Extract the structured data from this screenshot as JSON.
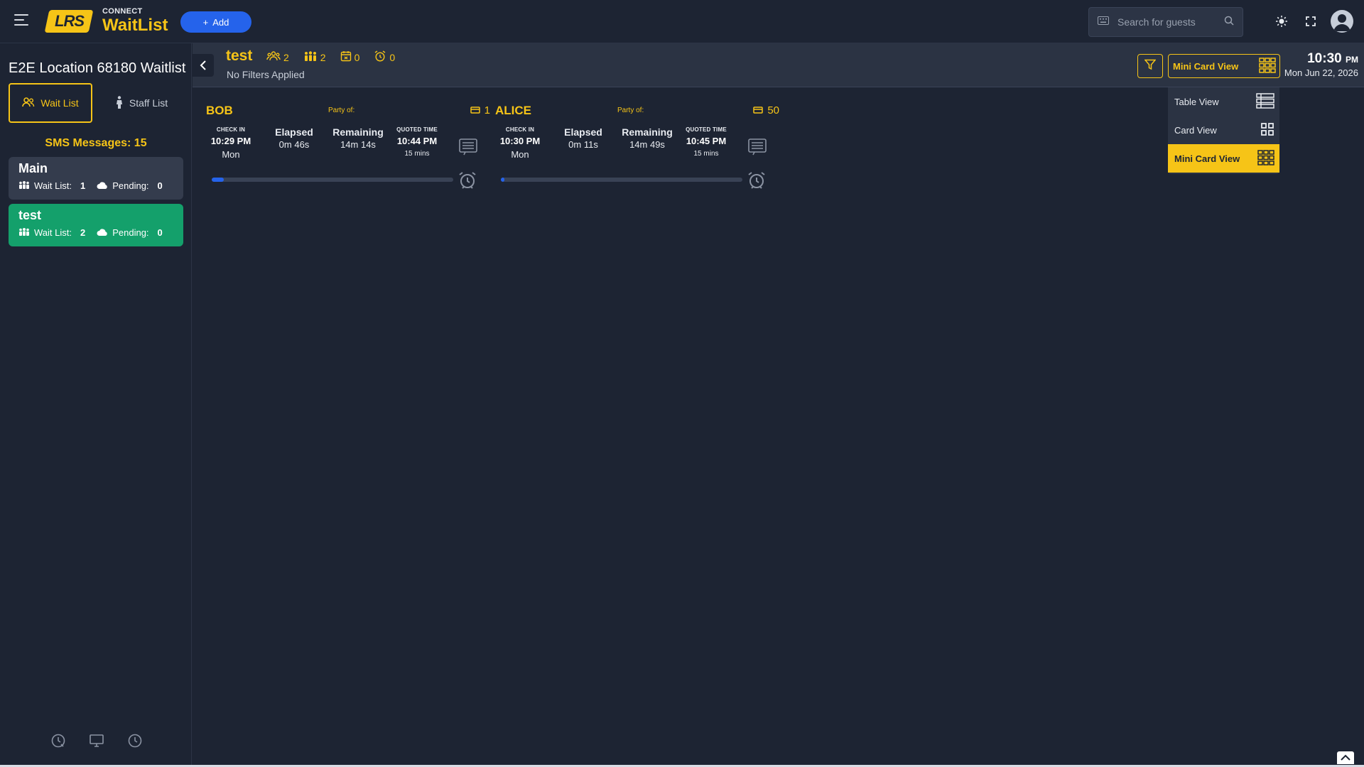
{
  "app": {
    "logo_text": "LRS",
    "product_small": "CONNECT",
    "product_big": "WaitList",
    "add_label": "Add"
  },
  "search": {
    "placeholder": "Search for guests"
  },
  "sidebar": {
    "location_title": "E2E Location 68180 Waitlist",
    "tabs": [
      {
        "label": "Wait List",
        "active": true
      },
      {
        "label": "Staff List",
        "active": false
      }
    ],
    "sms_label": "SMS Messages: 15",
    "lists": [
      {
        "name": "Main",
        "waitlist_label": "Wait List:",
        "waitlist_count": "1",
        "pending_label": "Pending:",
        "pending_count": "0"
      },
      {
        "name": "test",
        "waitlist_label": "Wait List:",
        "waitlist_count": "2",
        "pending_label": "Pending:",
        "pending_count": "0"
      }
    ]
  },
  "subheader": {
    "list_name": "test",
    "stats": {
      "parties": "2",
      "guests": "2",
      "reservations": "0",
      "alarms": "0"
    },
    "filters_text": "No Filters Applied",
    "view_selected": "Mini Card View",
    "time": "10:30",
    "ampm": "PM",
    "date": "Mon Jun 22, 2026"
  },
  "view_menu": [
    {
      "label": "Table View",
      "icon": "table-view-icon"
    },
    {
      "label": "Card View",
      "icon": "card-view-icon"
    },
    {
      "label": "Mini Card View",
      "icon": "mini-card-view-icon",
      "selected": true
    }
  ],
  "guests": [
    {
      "name": "BOB",
      "party_label": "Party of:",
      "table": "1",
      "checkin_label": "CHECK IN",
      "checkin_time": "10:29 PM",
      "checkin_day": "Mon",
      "elapsed_label": "Elapsed",
      "elapsed": "0m 46s",
      "remaining_label": "Remaining",
      "remaining": "14m 14s",
      "quoted_label": "QUOTED TIME",
      "quoted_time": "10:44 PM",
      "quoted_mins": "15 mins",
      "progress": 0.05
    },
    {
      "name": "ALICE",
      "party_label": "Party of:",
      "table": "50",
      "checkin_label": "CHECK IN",
      "checkin_time": "10:30 PM",
      "checkin_day": "Mon",
      "elapsed_label": "Elapsed",
      "elapsed": "0m 11s",
      "remaining_label": "Remaining",
      "remaining": "14m 49s",
      "quoted_label": "QUOTED TIME",
      "quoted_time": "10:45 PM",
      "quoted_mins": "15 mins",
      "progress": 0.01
    }
  ],
  "colors": {
    "accent": "#f6c417",
    "primary": "#2563eb",
    "background": "#1d2433",
    "panel": "#2b3343",
    "active_list": "#14a06b"
  }
}
